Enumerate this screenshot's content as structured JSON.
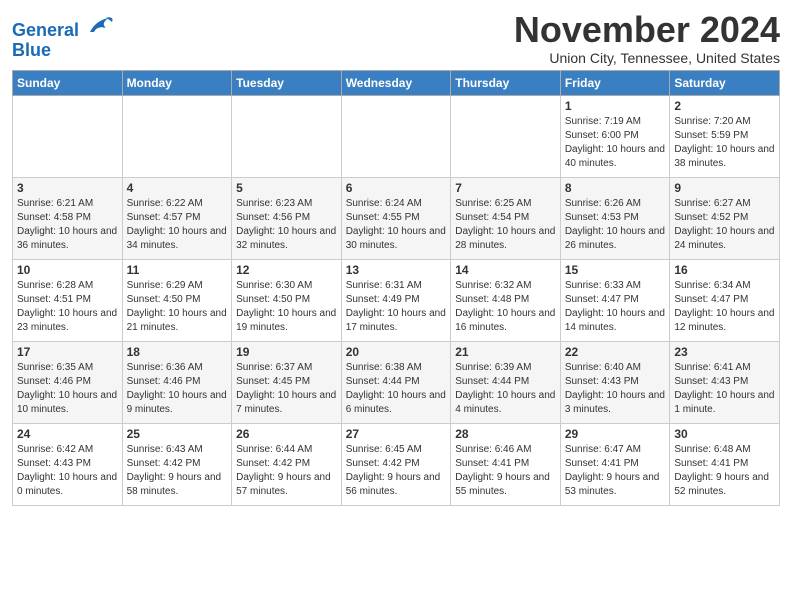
{
  "logo": {
    "line1": "General",
    "line2": "Blue"
  },
  "title": "November 2024",
  "subtitle": "Union City, Tennessee, United States",
  "headers": [
    "Sunday",
    "Monday",
    "Tuesday",
    "Wednesday",
    "Thursday",
    "Friday",
    "Saturday"
  ],
  "weeks": [
    [
      {
        "day": "",
        "info": ""
      },
      {
        "day": "",
        "info": ""
      },
      {
        "day": "",
        "info": ""
      },
      {
        "day": "",
        "info": ""
      },
      {
        "day": "",
        "info": ""
      },
      {
        "day": "1",
        "info": "Sunrise: 7:19 AM\nSunset: 6:00 PM\nDaylight: 10 hours and 40 minutes."
      },
      {
        "day": "2",
        "info": "Sunrise: 7:20 AM\nSunset: 5:59 PM\nDaylight: 10 hours and 38 minutes."
      }
    ],
    [
      {
        "day": "3",
        "info": "Sunrise: 6:21 AM\nSunset: 4:58 PM\nDaylight: 10 hours and 36 minutes."
      },
      {
        "day": "4",
        "info": "Sunrise: 6:22 AM\nSunset: 4:57 PM\nDaylight: 10 hours and 34 minutes."
      },
      {
        "day": "5",
        "info": "Sunrise: 6:23 AM\nSunset: 4:56 PM\nDaylight: 10 hours and 32 minutes."
      },
      {
        "day": "6",
        "info": "Sunrise: 6:24 AM\nSunset: 4:55 PM\nDaylight: 10 hours and 30 minutes."
      },
      {
        "day": "7",
        "info": "Sunrise: 6:25 AM\nSunset: 4:54 PM\nDaylight: 10 hours and 28 minutes."
      },
      {
        "day": "8",
        "info": "Sunrise: 6:26 AM\nSunset: 4:53 PM\nDaylight: 10 hours and 26 minutes."
      },
      {
        "day": "9",
        "info": "Sunrise: 6:27 AM\nSunset: 4:52 PM\nDaylight: 10 hours and 24 minutes."
      }
    ],
    [
      {
        "day": "10",
        "info": "Sunrise: 6:28 AM\nSunset: 4:51 PM\nDaylight: 10 hours and 23 minutes."
      },
      {
        "day": "11",
        "info": "Sunrise: 6:29 AM\nSunset: 4:50 PM\nDaylight: 10 hours and 21 minutes."
      },
      {
        "day": "12",
        "info": "Sunrise: 6:30 AM\nSunset: 4:50 PM\nDaylight: 10 hours and 19 minutes."
      },
      {
        "day": "13",
        "info": "Sunrise: 6:31 AM\nSunset: 4:49 PM\nDaylight: 10 hours and 17 minutes."
      },
      {
        "day": "14",
        "info": "Sunrise: 6:32 AM\nSunset: 4:48 PM\nDaylight: 10 hours and 16 minutes."
      },
      {
        "day": "15",
        "info": "Sunrise: 6:33 AM\nSunset: 4:47 PM\nDaylight: 10 hours and 14 minutes."
      },
      {
        "day": "16",
        "info": "Sunrise: 6:34 AM\nSunset: 4:47 PM\nDaylight: 10 hours and 12 minutes."
      }
    ],
    [
      {
        "day": "17",
        "info": "Sunrise: 6:35 AM\nSunset: 4:46 PM\nDaylight: 10 hours and 10 minutes."
      },
      {
        "day": "18",
        "info": "Sunrise: 6:36 AM\nSunset: 4:46 PM\nDaylight: 10 hours and 9 minutes."
      },
      {
        "day": "19",
        "info": "Sunrise: 6:37 AM\nSunset: 4:45 PM\nDaylight: 10 hours and 7 minutes."
      },
      {
        "day": "20",
        "info": "Sunrise: 6:38 AM\nSunset: 4:44 PM\nDaylight: 10 hours and 6 minutes."
      },
      {
        "day": "21",
        "info": "Sunrise: 6:39 AM\nSunset: 4:44 PM\nDaylight: 10 hours and 4 minutes."
      },
      {
        "day": "22",
        "info": "Sunrise: 6:40 AM\nSunset: 4:43 PM\nDaylight: 10 hours and 3 minutes."
      },
      {
        "day": "23",
        "info": "Sunrise: 6:41 AM\nSunset: 4:43 PM\nDaylight: 10 hours and 1 minute."
      }
    ],
    [
      {
        "day": "24",
        "info": "Sunrise: 6:42 AM\nSunset: 4:43 PM\nDaylight: 10 hours and 0 minutes."
      },
      {
        "day": "25",
        "info": "Sunrise: 6:43 AM\nSunset: 4:42 PM\nDaylight: 9 hours and 58 minutes."
      },
      {
        "day": "26",
        "info": "Sunrise: 6:44 AM\nSunset: 4:42 PM\nDaylight: 9 hours and 57 minutes."
      },
      {
        "day": "27",
        "info": "Sunrise: 6:45 AM\nSunset: 4:42 PM\nDaylight: 9 hours and 56 minutes."
      },
      {
        "day": "28",
        "info": "Sunrise: 6:46 AM\nSunset: 4:41 PM\nDaylight: 9 hours and 55 minutes."
      },
      {
        "day": "29",
        "info": "Sunrise: 6:47 AM\nSunset: 4:41 PM\nDaylight: 9 hours and 53 minutes."
      },
      {
        "day": "30",
        "info": "Sunrise: 6:48 AM\nSunset: 4:41 PM\nDaylight: 9 hours and 52 minutes."
      }
    ]
  ]
}
